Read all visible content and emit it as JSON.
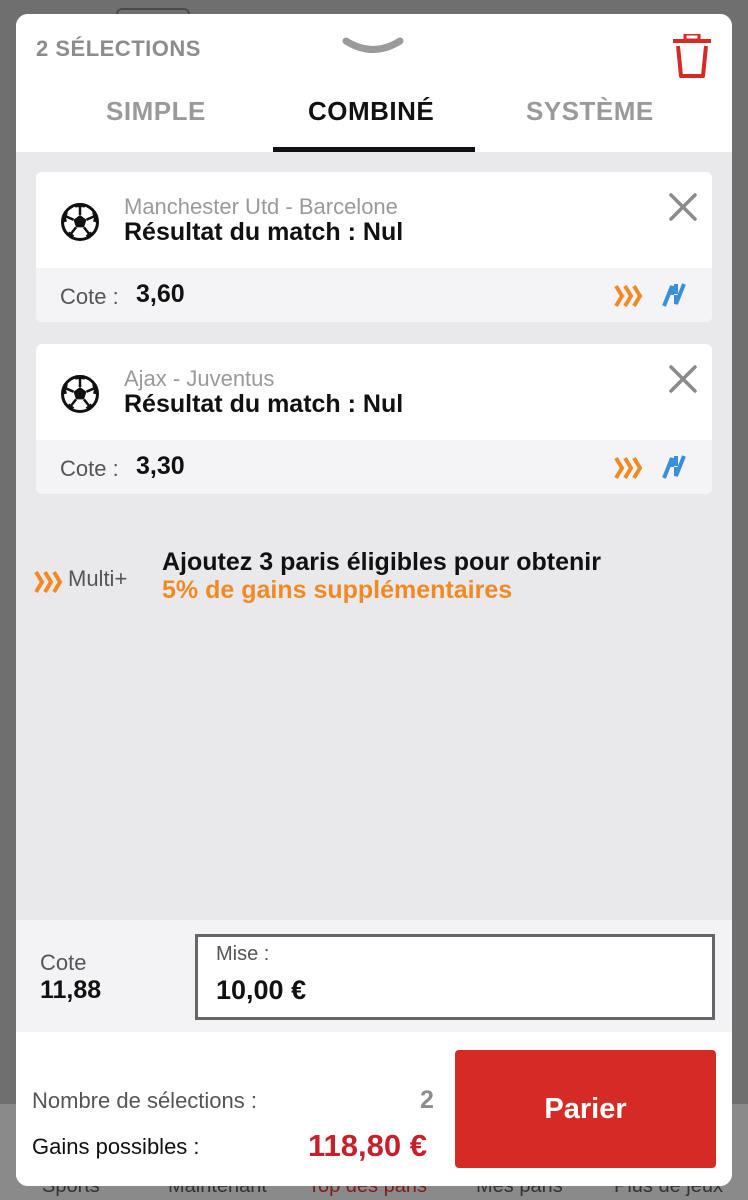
{
  "colors": {
    "accent_red": "#d62b24",
    "gain_red": "#c8202b",
    "orange": "#f08a24",
    "blue": "#3b8fd9",
    "tab_active": "#111111",
    "tab_inactive": "#9a9a9a"
  },
  "header": {
    "selection_count": "2 SÉLECTIONS",
    "handle_icon": "chevron-down-icon",
    "trash_icon": "trash-icon"
  },
  "tabs": [
    {
      "label": "SIMPLE",
      "active": false
    },
    {
      "label": "COMBINÉ",
      "active": true
    },
    {
      "label": "SYSTÈME",
      "active": false
    }
  ],
  "selections": [
    {
      "match": "Manchester Utd - Barcelone",
      "market": "Résultat du match : Nul",
      "odds_label": "Cote :",
      "odds": "3,60",
      "icon": "soccer-ball-icon"
    },
    {
      "match": "Ajax - Juventus",
      "market": "Résultat du match : Nul",
      "odds_label": "Cote :",
      "odds": "3,30",
      "icon": "soccer-ball-icon"
    }
  ],
  "multi": {
    "label": "Multi+",
    "line1": "Ajoutez 3 paris éligibles pour obtenir",
    "line2": "5% de gains supplémentaires"
  },
  "stake": {
    "total_odds_label": "Cote",
    "total_odds": "11,88",
    "mise_label": "Mise :",
    "mise_value": "10,00 €"
  },
  "summary": {
    "count_label": "Nombre de sélections :",
    "count": "2",
    "gains_label": "Gains possibles :",
    "gains": "118,80 €",
    "bet_button": "Parier"
  },
  "background_nav": [
    "Sports",
    "Maintenant",
    "Top des paris",
    "Mes paris",
    "Plus de jeux"
  ]
}
